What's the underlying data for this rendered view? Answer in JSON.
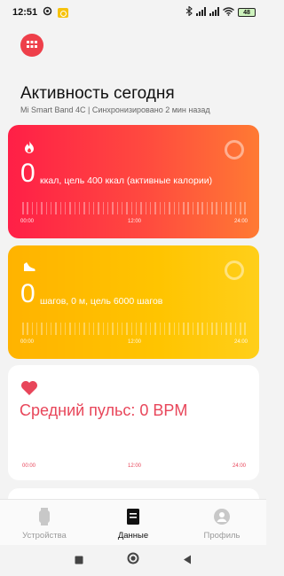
{
  "status_bar": {
    "time": "12:51",
    "battery": "48"
  },
  "header": {
    "title": "Активность сегодня",
    "subtitle": "Mi Smart Band 4C | Синхронизировано 2 мин назад"
  },
  "calories_card": {
    "value": "0",
    "description": "ккал, цель 400 ккал (активные калории)",
    "axis": [
      "00:00",
      "12:00",
      "24:00"
    ],
    "gradient_start": "#ff1f47",
    "gradient_end": "#ff7a33",
    "icon": "flame-icon"
  },
  "steps_card": {
    "value": "0",
    "description": "шагов, 0 м, цель 6000 шагов",
    "axis": [
      "00:00",
      "12:00",
      "24:00"
    ],
    "gradient_start": "#ffb300",
    "gradient_end": "#ffcf1a",
    "icon": "shoe-icon"
  },
  "heart_card": {
    "title": "Средний пульс: 0 BPM",
    "axis": [
      "00:00",
      "12:00",
      "24:00"
    ],
    "accent": "#e8465a",
    "icon": "heart-icon"
  },
  "bottom_nav": {
    "items": [
      {
        "label": "Устройства",
        "icon": "watch-icon",
        "active": false
      },
      {
        "label": "Данные",
        "icon": "document-icon",
        "active": true
      },
      {
        "label": "Профиль",
        "icon": "profile-icon",
        "active": false
      }
    ]
  },
  "accent": "#ee3f4a"
}
